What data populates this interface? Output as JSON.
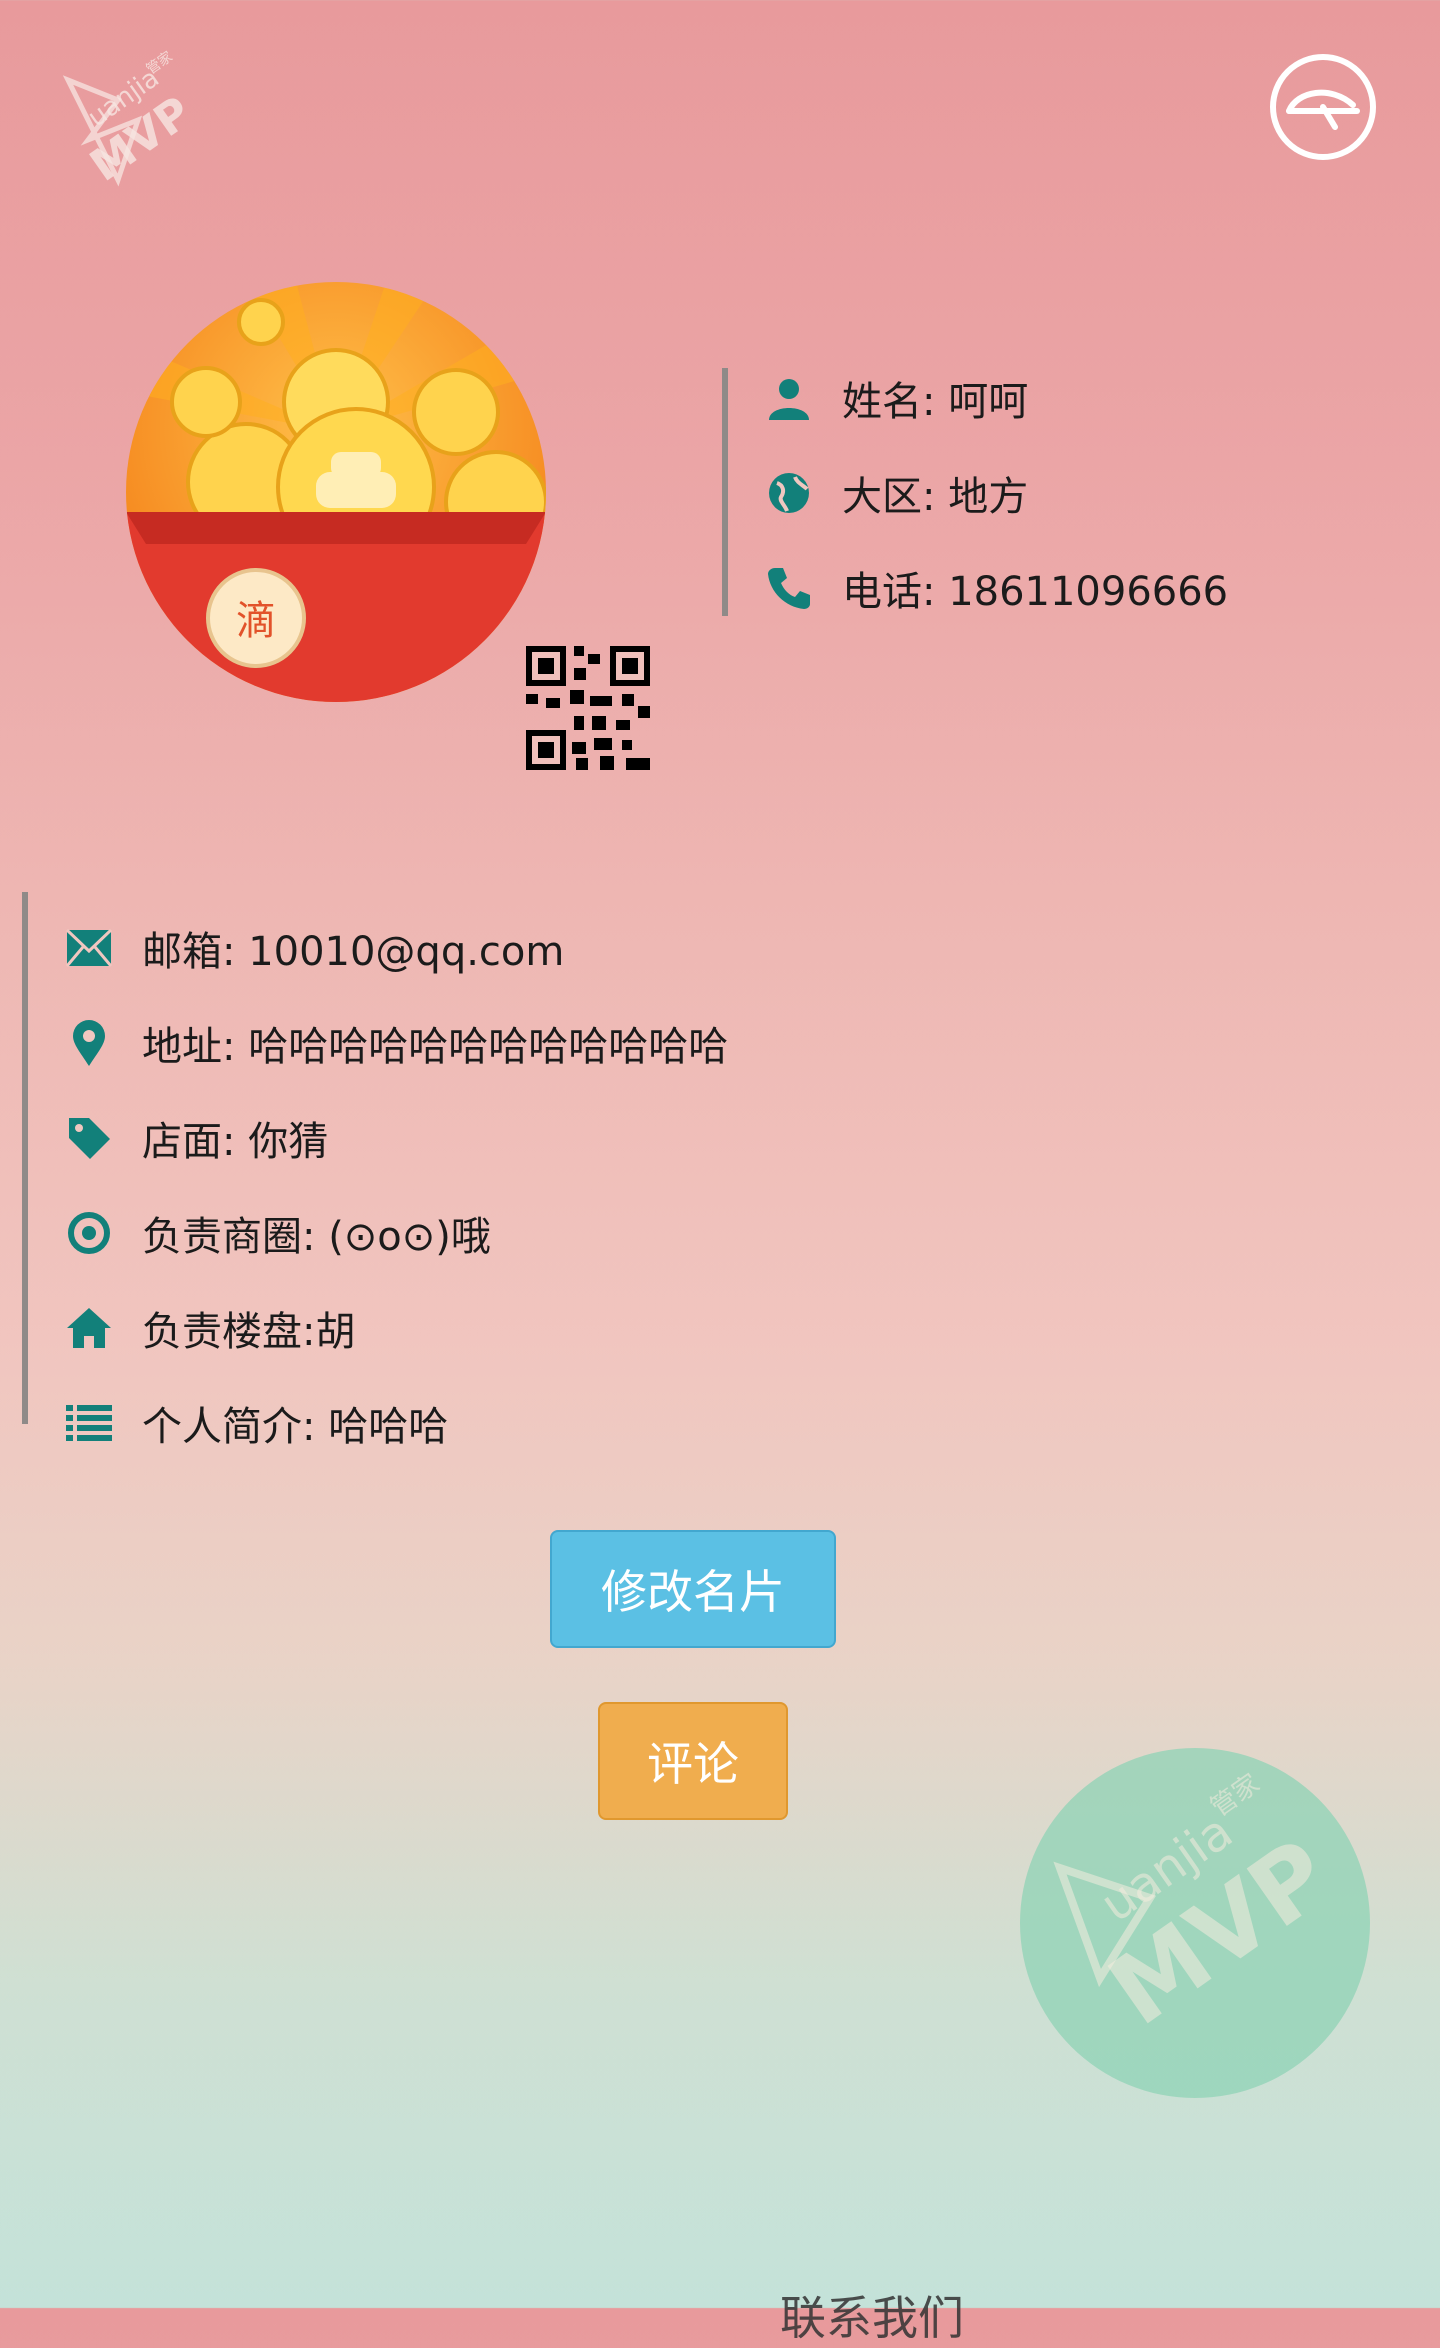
{
  "brand": {
    "logo_text": "uanjia",
    "logo_cn": "管家",
    "logo_mark": "MVP"
  },
  "profile": {
    "avatar_badge": "滴",
    "name": "姓名: 呵呵",
    "region": "大区: 地方",
    "phone": "电话: 18611096666"
  },
  "details": {
    "email": "邮箱: 10010@qq.com",
    "address": "地址: 哈哈哈哈哈哈哈哈哈哈哈哈",
    "store": "店面: 你猜",
    "business_area": "负责商圈: (⊙o⊙)哦",
    "property": "负责楼盘:胡",
    "bio": "个人简介: 哈哈哈"
  },
  "actions": {
    "edit_label": "修改名片",
    "comment_label": "评论"
  },
  "footer": {
    "partial_text": "联系我们"
  },
  "colors": {
    "accent_teal": "#12807a",
    "edit_button": "#5bc0e4",
    "comment_button": "#f0ad4e",
    "divider": "#8f8a88"
  }
}
